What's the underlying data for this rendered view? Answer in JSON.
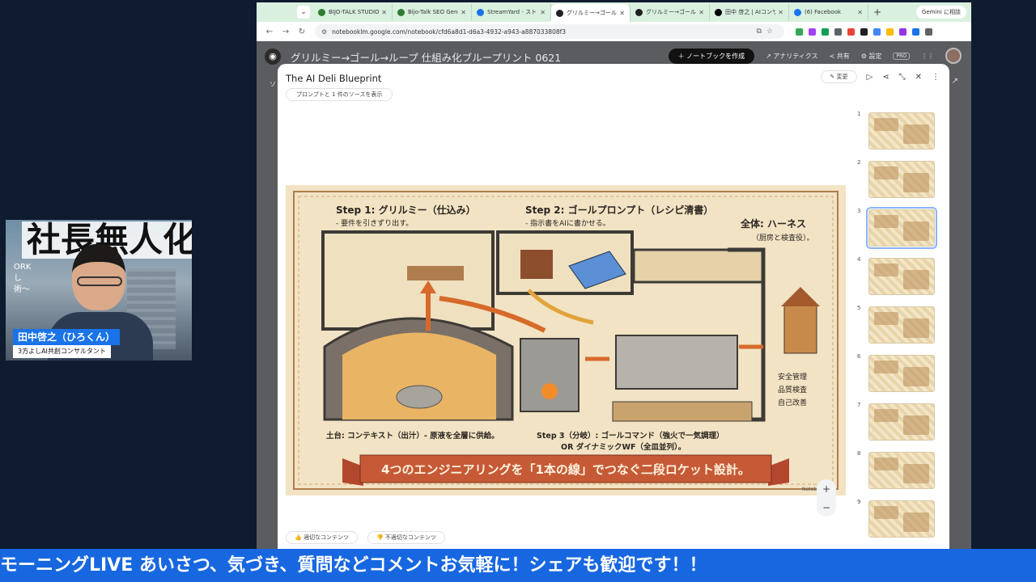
{
  "webcam": {
    "banner_text": "社長無人化",
    "side_text_1": "ORK",
    "side_text_2": "し",
    "side_text_3": "術〜",
    "name": "田中啓之（ひろくん）",
    "role": "3方よしAI共創コンサルタント"
  },
  "ticker": {
    "text": "モーニングLIVE あいさつ、気づき、質問などコメントお気軽に！シェアも歓迎です！！"
  },
  "browser": {
    "tabs": [
      {
        "title": "BIJO-TALK STUDIO",
        "color": "#2e7d32"
      },
      {
        "title": "Bijo-Talk SEO Gene",
        "color": "#2e7d32"
      },
      {
        "title": "StreamYard - スト",
        "color": "#1a73e8"
      },
      {
        "title": "グリルミー→ゴール",
        "color": "#202124"
      },
      {
        "title": "グリルミー→ゴール",
        "color": "#202124"
      },
      {
        "title": "田中 啓之 | AIコンサ",
        "color": "#000000"
      },
      {
        "title": "(6) Facebook",
        "color": "#1877f2"
      }
    ],
    "gemini_label": "Gemini に相談",
    "url": "notebooklm.google.com/notebook/cfd6a8d1-d6a3-4932-a943-a887033808f3",
    "extension_colors": [
      "#34a853",
      "#a142f4",
      "#0f9d58",
      "#5f6368",
      "#ea4335",
      "#202124",
      "#4285f4",
      "#fbbc04",
      "#9334e6",
      "#1a73e8",
      "#5f6368"
    ]
  },
  "notebook": {
    "title": "グリルミー→ゴール→ループ 仕組み化ブループリント 0621",
    "create_button": "＋ ノートブックを作成",
    "analytics": "アナリティクス",
    "share": "共有",
    "settings": "設定",
    "pro": "PRO",
    "bg_left": "ソ",
    "bg_right": "↗"
  },
  "modal": {
    "title": "The AI Deli Blueprint",
    "source_chip": "プロンプトと 1 件のソースを表示",
    "edit_label": "変更",
    "good_content": "適切なコンテンツ",
    "bad_content": "不適切なコンテンツ",
    "zoom_in": "+",
    "zoom_out": "−"
  },
  "slide": {
    "step1_title": "Step 1: グリルミー（仕込み）",
    "step1_sub": "- 要件を引きずり出す。",
    "step2_title": "Step 2: ゴールプロンプト（レシピ清書）",
    "step2_sub": "- 指示書をAIに書かせる。",
    "harness_title": "全体: ハーネス",
    "harness_sub": "（厨房と検査役）。",
    "safety": "安全管理",
    "quality": "品質検査",
    "improve": "自己改善",
    "foundation": "土台: コンテキスト（出汁）- 原液を全層に供給。",
    "step3_line1": "Step 3（分岐）: ゴールコマンド（強火で一気調理）",
    "step3_line2": "OR ダイナミックWF（全皿並列）。",
    "banner": "4つのエンジニアリングを「1本の線」でつなぐ二段ロケット設計。",
    "watermark": "NotebookLM"
  },
  "thumbnails": [
    {
      "num": "1"
    },
    {
      "num": "2"
    },
    {
      "num": "3"
    },
    {
      "num": "4"
    },
    {
      "num": "5"
    },
    {
      "num": "6"
    },
    {
      "num": "7"
    },
    {
      "num": "8"
    },
    {
      "num": "9"
    }
  ],
  "selected_thumbnail": "3"
}
